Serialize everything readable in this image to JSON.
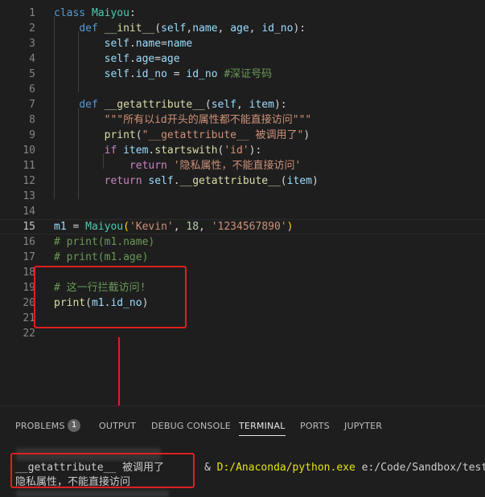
{
  "editor": {
    "lines": [
      {
        "n": "1",
        "tokens": [
          {
            "c": "kw",
            "t": "class"
          },
          {
            "c": "pl",
            "t": " "
          },
          {
            "c": "cls",
            "t": "Maiyou"
          },
          {
            "c": "pl",
            "t": ":"
          }
        ]
      },
      {
        "n": "2",
        "tokens": [
          {
            "c": "pl",
            "t": "    "
          },
          {
            "c": "kw",
            "t": "def"
          },
          {
            "c": "pl",
            "t": " "
          },
          {
            "c": "fn",
            "t": "__init__"
          },
          {
            "c": "pl",
            "t": "("
          },
          {
            "c": "var",
            "t": "self"
          },
          {
            "c": "pl",
            "t": ","
          },
          {
            "c": "var",
            "t": "name"
          },
          {
            "c": "pl",
            "t": ", "
          },
          {
            "c": "var",
            "t": "age"
          },
          {
            "c": "pl",
            "t": ", "
          },
          {
            "c": "var",
            "t": "id_no"
          },
          {
            "c": "pl",
            "t": "):"
          }
        ]
      },
      {
        "n": "3",
        "tokens": [
          {
            "c": "pl",
            "t": "        "
          },
          {
            "c": "var",
            "t": "self"
          },
          {
            "c": "pl",
            "t": "."
          },
          {
            "c": "var",
            "t": "name"
          },
          {
            "c": "pl",
            "t": "="
          },
          {
            "c": "var",
            "t": "name"
          }
        ]
      },
      {
        "n": "4",
        "tokens": [
          {
            "c": "pl",
            "t": "        "
          },
          {
            "c": "var",
            "t": "self"
          },
          {
            "c": "pl",
            "t": "."
          },
          {
            "c": "var",
            "t": "age"
          },
          {
            "c": "pl",
            "t": "="
          },
          {
            "c": "var",
            "t": "age"
          }
        ]
      },
      {
        "n": "5",
        "tokens": [
          {
            "c": "pl",
            "t": "        "
          },
          {
            "c": "var",
            "t": "self"
          },
          {
            "c": "pl",
            "t": "."
          },
          {
            "c": "var",
            "t": "id_no"
          },
          {
            "c": "pl",
            "t": " = "
          },
          {
            "c": "var",
            "t": "id_no"
          },
          {
            "c": "pl",
            "t": " "
          },
          {
            "c": "cm",
            "t": "#深证号码"
          }
        ]
      },
      {
        "n": "6",
        "tokens": []
      },
      {
        "n": "7",
        "tokens": [
          {
            "c": "pl",
            "t": "    "
          },
          {
            "c": "kw",
            "t": "def"
          },
          {
            "c": "pl",
            "t": " "
          },
          {
            "c": "fn",
            "t": "__getattribute__"
          },
          {
            "c": "pl",
            "t": "("
          },
          {
            "c": "var",
            "t": "self"
          },
          {
            "c": "pl",
            "t": ", "
          },
          {
            "c": "var",
            "t": "item"
          },
          {
            "c": "pl",
            "t": "):"
          }
        ]
      },
      {
        "n": "8",
        "tokens": [
          {
            "c": "pl",
            "t": "        "
          },
          {
            "c": "str",
            "t": "\"\"\"所有以id开头的属性都不能直接访问\"\"\""
          }
        ]
      },
      {
        "n": "9",
        "tokens": [
          {
            "c": "pl",
            "t": "        "
          },
          {
            "c": "fn",
            "t": "print"
          },
          {
            "c": "pl",
            "t": "("
          },
          {
            "c": "str",
            "t": "\"__getattribute__ 被调用了\""
          },
          {
            "c": "pl",
            "t": ")"
          }
        ]
      },
      {
        "n": "10",
        "tokens": [
          {
            "c": "pl",
            "t": "        "
          },
          {
            "c": "ctl",
            "t": "if"
          },
          {
            "c": "pl",
            "t": " "
          },
          {
            "c": "var",
            "t": "item"
          },
          {
            "c": "pl",
            "t": "."
          },
          {
            "c": "fn",
            "t": "startswith"
          },
          {
            "c": "pl",
            "t": "("
          },
          {
            "c": "str",
            "t": "'id'"
          },
          {
            "c": "pl",
            "t": "):"
          }
        ]
      },
      {
        "n": "11",
        "tokens": [
          {
            "c": "pl",
            "t": "            "
          },
          {
            "c": "ctl",
            "t": "return"
          },
          {
            "c": "pl",
            "t": " "
          },
          {
            "c": "str",
            "t": "'隐私属性，不能直接访问'"
          }
        ]
      },
      {
        "n": "12",
        "tokens": [
          {
            "c": "pl",
            "t": "        "
          },
          {
            "c": "ctl",
            "t": "return"
          },
          {
            "c": "pl",
            "t": " "
          },
          {
            "c": "var",
            "t": "self"
          },
          {
            "c": "pl",
            "t": "."
          },
          {
            "c": "fn",
            "t": "__getattribute__"
          },
          {
            "c": "pl",
            "t": "("
          },
          {
            "c": "var",
            "t": "item"
          },
          {
            "c": "pl",
            "t": ")"
          }
        ]
      },
      {
        "n": "13",
        "tokens": []
      },
      {
        "n": "14",
        "tokens": []
      },
      {
        "n": "15",
        "tokens": [
          {
            "c": "var",
            "t": "m1"
          },
          {
            "c": "pl",
            "t": " = "
          },
          {
            "c": "cls",
            "t": "Maiyou"
          },
          {
            "c": "brk",
            "t": "("
          },
          {
            "c": "str",
            "t": "'Kevin'"
          },
          {
            "c": "pl",
            "t": ", "
          },
          {
            "c": "num",
            "t": "18"
          },
          {
            "c": "pl",
            "t": ", "
          },
          {
            "c": "str",
            "t": "'1234567890'"
          },
          {
            "c": "brk",
            "t": ")"
          }
        ],
        "active": true
      },
      {
        "n": "16",
        "tokens": [
          {
            "c": "cm",
            "t": "# print(m1.name)"
          }
        ]
      },
      {
        "n": "17",
        "tokens": [
          {
            "c": "cm",
            "t": "# print(m1.age)"
          }
        ]
      },
      {
        "n": "18",
        "tokens": []
      },
      {
        "n": "19",
        "tokens": [
          {
            "c": "cm",
            "t": "# 这一行拦截访问!"
          }
        ]
      },
      {
        "n": "20",
        "tokens": [
          {
            "c": "fn",
            "t": "print"
          },
          {
            "c": "pl",
            "t": "("
          },
          {
            "c": "var",
            "t": "m1"
          },
          {
            "c": "pl",
            "t": "."
          },
          {
            "c": "var",
            "t": "id_no"
          },
          {
            "c": "pl",
            "t": ")"
          }
        ]
      },
      {
        "n": "21",
        "tokens": []
      },
      {
        "n": "22",
        "tokens": []
      }
    ]
  },
  "panel": {
    "tabs": [
      {
        "label": "PROBLEMS",
        "active": false
      },
      {
        "label": "OUTPUT",
        "active": false
      },
      {
        "label": "DEBUG CONSOLE",
        "active": false
      },
      {
        "label": "TERMINAL",
        "active": true
      },
      {
        "label": "PORTS",
        "active": false
      },
      {
        "label": "JUPYTER",
        "active": false
      }
    ],
    "problems_count": "1"
  },
  "terminal": {
    "command_prefix": "& ",
    "command_exe": "D:/Anaconda/python.exe",
    "command_arg": " e:/Code/Sandbox/test.py",
    "output_line_1": "__getattribute__ 被调用了",
    "output_line_2": "隐私属性，不能直接访问"
  },
  "colors": {
    "annotation_red": "#e02020",
    "editor_bg": "#1e1e1e"
  }
}
